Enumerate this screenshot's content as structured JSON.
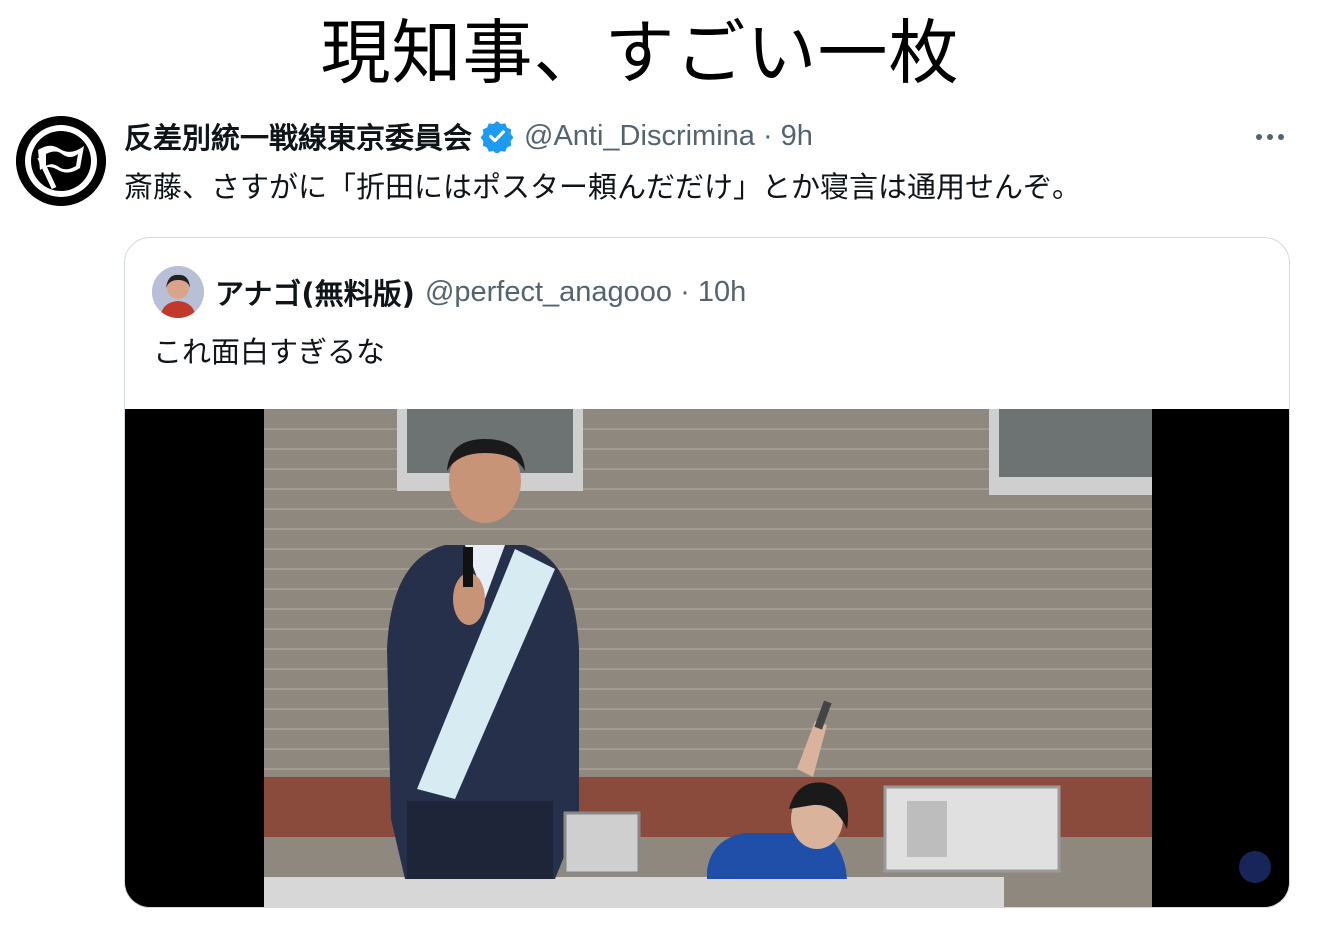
{
  "headline": "現知事、すごい一枚",
  "tweet": {
    "author_name": "反差別統一戦線東京委員会",
    "handle_time": "@Anti_Discrimina · 9h",
    "text": "斎藤、さすがに「折田にはポスター頼んだだけ」とか寝言は通用せんぞ。",
    "avatar_icon": "antifa-flag-logo",
    "verified_icon": "verified-badge-icon",
    "verified_color": "#1d9bf0"
  },
  "quote": {
    "author_name": "アナゴ(無料版)",
    "handle_time": "@perfect_anagooo · 10h",
    "text": "これ面白すぎるな",
    "media_icon": "video-thumbnail"
  },
  "colors": {
    "text_primary": "#0f1419",
    "text_secondary": "#536471",
    "border": "#cfd9de"
  }
}
